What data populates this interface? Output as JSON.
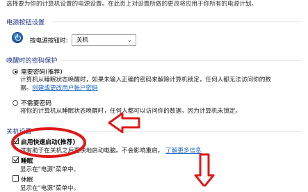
{
  "intro_text": "选择要为你的计算机设置的电源设置。在此页上对设置所做的更改将应用于你所有的电源计划。",
  "power_button_section": {
    "title": "电源按钮设置",
    "field_label": "按电源按钮时:",
    "selected_value": "关机"
  },
  "password_section": {
    "title": "唤醒时的密码保护",
    "require_password": {
      "label": "需要密码(推荐)",
      "description_line1": "计算机从睡眠状态唤醒时，如果未输入正确的密码来解除计算机锁定，任何人都无法访问你的数",
      "description_line2": "据。",
      "link_text": "创建或更改用户帐户密码"
    },
    "no_password": {
      "label": "不需要密码",
      "description_line1": "将你的计算机从睡眠状态唤醒时，任何人都可以访问你的数据，因为计算机未锁定。"
    }
  },
  "shutdown_section": {
    "title": "关机设置",
    "fast_startup": {
      "label": "启用快速启动(推荐)",
      "description": "这有助于在关机之后更快地启动电脑。不会影响重启。",
      "link_text": "了解更多信息"
    },
    "sleep": {
      "label": "睡眠",
      "description": "显示在\"电源\"菜单中。"
    },
    "hibernate": {
      "label": "休眠",
      "description": "显示在\"电源\"菜单中。"
    }
  },
  "annotation_color": "#e01818"
}
